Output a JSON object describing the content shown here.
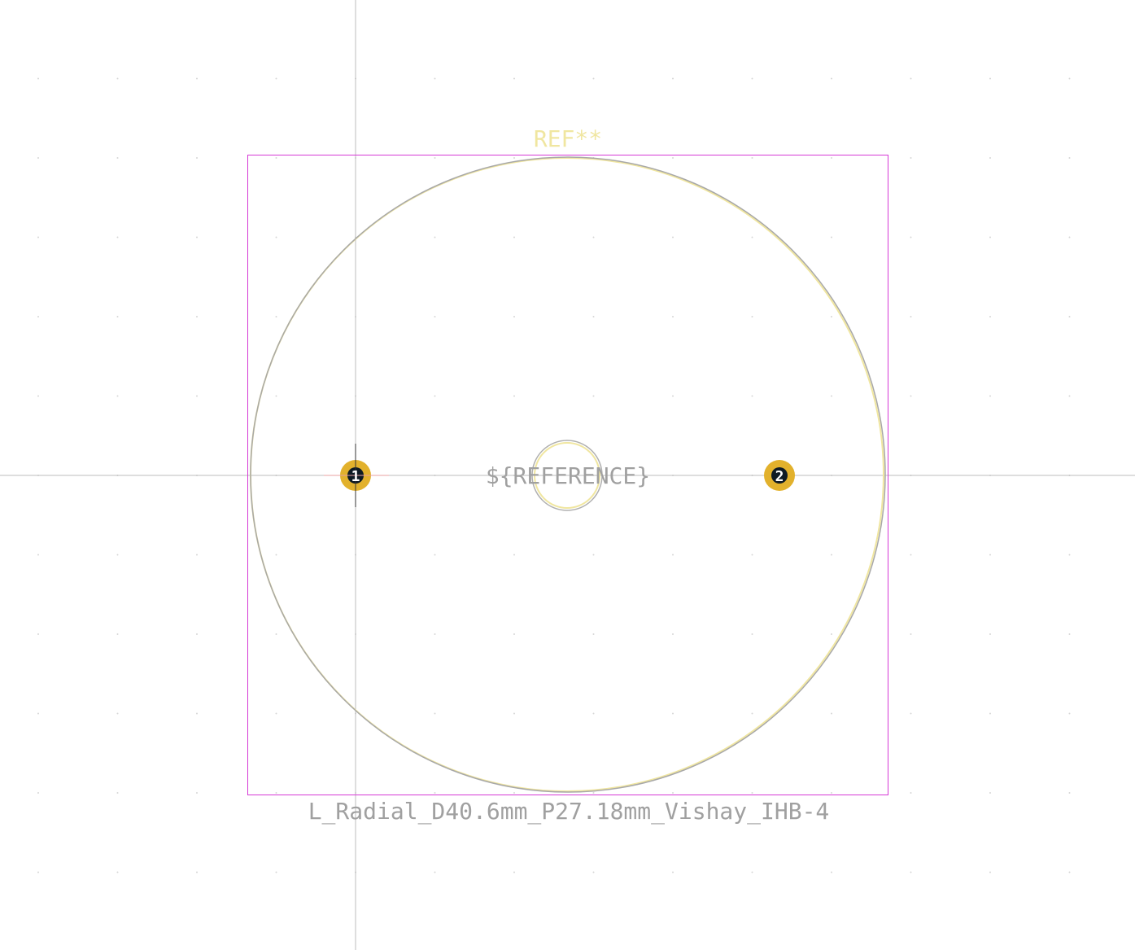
{
  "footprint": {
    "reference": "REF**",
    "reference_field": "${REFERENCE}",
    "value": "L_Radial_D40.6mm_P27.18mm_Vishay_IHB-4"
  },
  "pads": [
    {
      "number": "1"
    },
    {
      "number": "2"
    }
  ],
  "colors": {
    "background": "#ffffff",
    "grid_dot": "#d6d6d6",
    "crosshair": "#bdbdbd",
    "courtyard": "#d63ad6",
    "silkscreen": "#f0e6a0",
    "fab": "#a8a8a8",
    "pad": "#e2b12c",
    "pad_hole": "#0e1a24",
    "value_text": "#a0a0a0",
    "pad_text": "#ffffff"
  }
}
